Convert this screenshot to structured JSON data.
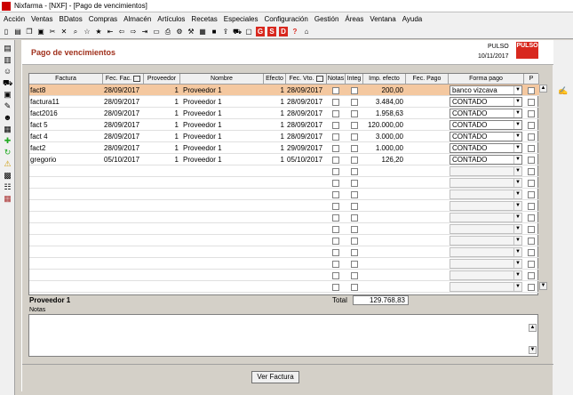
{
  "window": {
    "title": "Nixfarma - [NXF] - [Pago de vencimientos]"
  },
  "menu": [
    "Acción",
    "Ventas",
    "BDatos",
    "Compras",
    "Almacén",
    "Artículos",
    "Recetas",
    "Especiales",
    "Configuración",
    "Gestión",
    "Áreas",
    "Ventana",
    "Ayuda"
  ],
  "toolbar": {
    "red_buttons": [
      "G",
      "S",
      "D"
    ],
    "help": "?"
  },
  "header": {
    "title": "Pago de vencimientos",
    "brand": "PULSO",
    "date": "10/11/2017",
    "logo_text": "PULSO"
  },
  "table": {
    "headers": {
      "factura": "Factura",
      "fec_fac": "Fec. Fac.",
      "proveedor": "Proveedor",
      "nombre": "Nombre",
      "efecto": "Efecto",
      "fec_vto": "Fec. Vto.",
      "notas": "Notas",
      "integ": "Integ",
      "imp_efecto": "Imp. efecto",
      "fec_pago": "Fec. Pago",
      "forma_pago": "Forma pago",
      "p": "P"
    },
    "rows": [
      {
        "factura": "fact8",
        "fec_fac": "28/09/2017",
        "proveedor": "1",
        "nombre": "Proveedor 1",
        "efecto": "1",
        "fec_vto": "28/09/2017",
        "imp": "200,00",
        "fec_pago": "",
        "forma": "banco vizcava"
      },
      {
        "factura": "factura11",
        "fec_fac": "28/09/2017",
        "proveedor": "1",
        "nombre": "Proveedor 1",
        "efecto": "1",
        "fec_vto": "28/09/2017",
        "imp": "3.484,00",
        "fec_pago": "",
        "forma": "CONTADO"
      },
      {
        "factura": "fact2016",
        "fec_fac": "28/09/2017",
        "proveedor": "1",
        "nombre": "Proveedor 1",
        "efecto": "1",
        "fec_vto": "28/09/2017",
        "imp": "1.958,63",
        "fec_pago": "",
        "forma": "CONTADO"
      },
      {
        "factura": "fact 5",
        "fec_fac": "28/09/2017",
        "proveedor": "1",
        "nombre": "Proveedor 1",
        "efecto": "1",
        "fec_vto": "28/09/2017",
        "imp": "120.000,00",
        "fec_pago": "",
        "forma": "CONTADO"
      },
      {
        "factura": "fact 4",
        "fec_fac": "28/09/2017",
        "proveedor": "1",
        "nombre": "Proveedor 1",
        "efecto": "1",
        "fec_vto": "28/09/2017",
        "imp": "3.000,00",
        "fec_pago": "",
        "forma": "CONTADO"
      },
      {
        "factura": "fact2",
        "fec_fac": "28/09/2017",
        "proveedor": "1",
        "nombre": "Proveedor 1",
        "efecto": "1",
        "fec_vto": "29/09/2017",
        "imp": "1.000,00",
        "fec_pago": "",
        "forma": "CONTADO"
      },
      {
        "factura": "gregorio",
        "fec_fac": "05/10/2017",
        "proveedor": "1",
        "nombre": "Proveedor 1",
        "efecto": "1",
        "fec_vto": "05/10/2017",
        "imp": "126,20",
        "fec_pago": "",
        "forma": "CONTADO"
      }
    ],
    "empty_rows": 11
  },
  "footer": {
    "proveedor": "Proveedor 1",
    "total_label": "Total",
    "total_value": "129.768,83",
    "notas_label": "Notas"
  },
  "buttons": {
    "ver_factura": "Ver Factura"
  }
}
